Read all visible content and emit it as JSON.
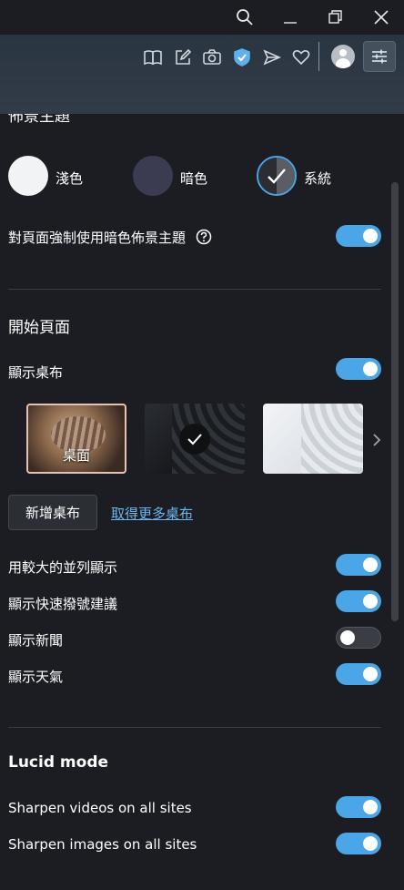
{
  "window": {
    "icons": [
      "search-icon",
      "minimize-icon",
      "restore-icon",
      "close-icon"
    ]
  },
  "toolbar": {
    "icons": [
      "reader-icon",
      "edit-icon",
      "camera-icon",
      "shield-icon",
      "send-icon",
      "heart-icon",
      "avatar",
      "settings-icon"
    ],
    "accent_color": "#4aa6e6"
  },
  "theme": {
    "section_title_partial": "佈景主題",
    "options": [
      {
        "label": "淺色",
        "color": "#f2f3f5"
      },
      {
        "label": "暗色",
        "color": "#3b3c52"
      },
      {
        "label": "系統",
        "selected": true
      }
    ],
    "force_dark": {
      "label": "對頁面強制使用暗色佈景主題",
      "on": true
    }
  },
  "start_page": {
    "title": "開始頁面",
    "show_wallpaper": {
      "label": "顯示桌布",
      "on": true
    },
    "wallpapers": [
      {
        "label": "桌面",
        "name": "cat"
      },
      {
        "name": "dark-waves",
        "selected": true
      },
      {
        "name": "light-waves"
      }
    ],
    "add_button": "新增桌布",
    "more_link": "取得更多桌布",
    "options": [
      {
        "label": "用較大的並列顯示",
        "on": true
      },
      {
        "label": "顯示快速撥號建議",
        "on": true
      },
      {
        "label": "顯示新聞",
        "on": false
      },
      {
        "label": "顯示天氣",
        "on": true
      }
    ]
  },
  "lucid": {
    "title": "Lucid mode",
    "options": [
      {
        "label": "Sharpen videos on all sites",
        "on": true
      },
      {
        "label": "Sharpen images on all sites",
        "on": true
      }
    ]
  }
}
